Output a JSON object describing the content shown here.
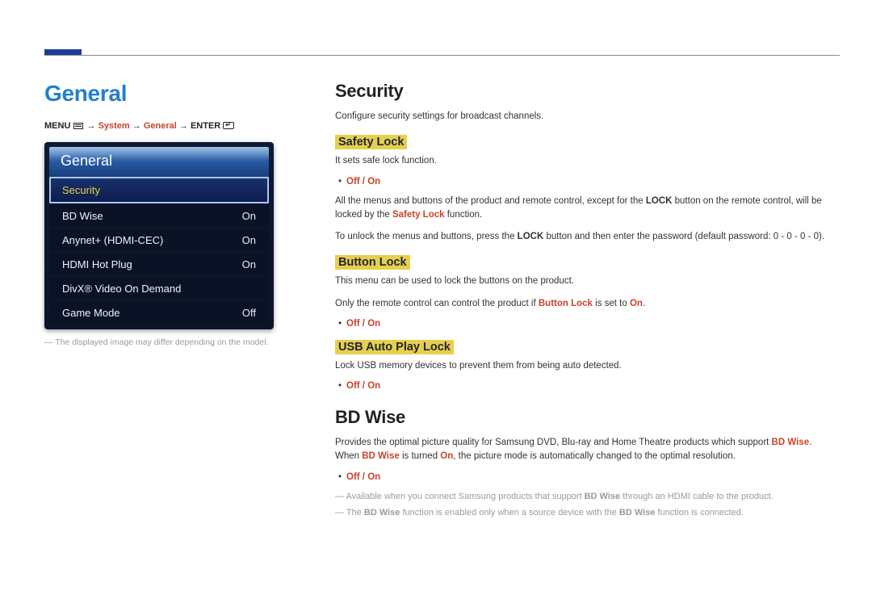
{
  "section_title": "General",
  "breadcrumb": {
    "menu": "MENU",
    "arrow": "→",
    "system": "System",
    "general": "General",
    "enter": "ENTER"
  },
  "tv_panel": {
    "header": "General",
    "rows": [
      {
        "label": "Security",
        "value": "",
        "highlight": true
      },
      {
        "label": "BD Wise",
        "value": "On",
        "highlight": false
      },
      {
        "label": "Anynet+ (HDMI-CEC)",
        "value": "On",
        "highlight": false
      },
      {
        "label": "HDMI Hot Plug",
        "value": "On",
        "highlight": false
      },
      {
        "label": "DivX® Video On Demand",
        "value": "",
        "highlight": false
      },
      {
        "label": "Game Mode",
        "value": "Off",
        "highlight": false
      }
    ],
    "footnote": "The displayed image may differ depending on the model."
  },
  "right": {
    "security_heading": "Security",
    "security_desc": "Configure security settings for broadcast channels.",
    "safety_lock_label": "Safety Lock",
    "safety_lock_desc1": "It sets safe lock function.",
    "off_on": "Off / On",
    "safety_lock_desc2a": "All the menus and buttons of the product and remote control, except for the ",
    "lock_word": "LOCK",
    "safety_lock_desc2b": " button on the remote control, will be locked by the ",
    "safety_lock_kw": "Safety Lock",
    "safety_lock_desc2c": " function.",
    "safety_lock_desc3a": "To unlock the menus and buttons, press the ",
    "safety_lock_desc3b": " button and then enter the password (default password: 0 - 0 - 0 - 0).",
    "button_lock_label": "Button Lock",
    "button_lock_desc1": "This menu can be used to lock the buttons on the product.",
    "button_lock_desc2a": "Only the remote control can control the product if ",
    "button_lock_kw": "Button Lock",
    "button_lock_desc2b": " is set to ",
    "on_word": "On",
    "period": ".",
    "usb_lock_label": "USB Auto Play Lock",
    "usb_lock_desc": "Lock USB memory devices to prevent them from being auto detected.",
    "bdwise_heading": "BD Wise",
    "bdwise_desc_a": "Provides the optimal picture quality for Samsung DVD, Blu-ray and Home Theatre products which support ",
    "bdwise_kw": "BD Wise",
    "bdwise_desc_b": ". When ",
    "bdwise_desc_c": " is turned ",
    "bdwise_desc_d": ", the picture mode is automatically changed to the optimal resolution.",
    "bdwise_note1a": "Available when you connect Samsung products that support ",
    "bdwise_note1b": " through an HDMI cable to the product.",
    "bdwise_note2a": "The ",
    "bdwise_note2b": " function is enabled only when a source device with the ",
    "bdwise_note2c": " function is connected."
  }
}
